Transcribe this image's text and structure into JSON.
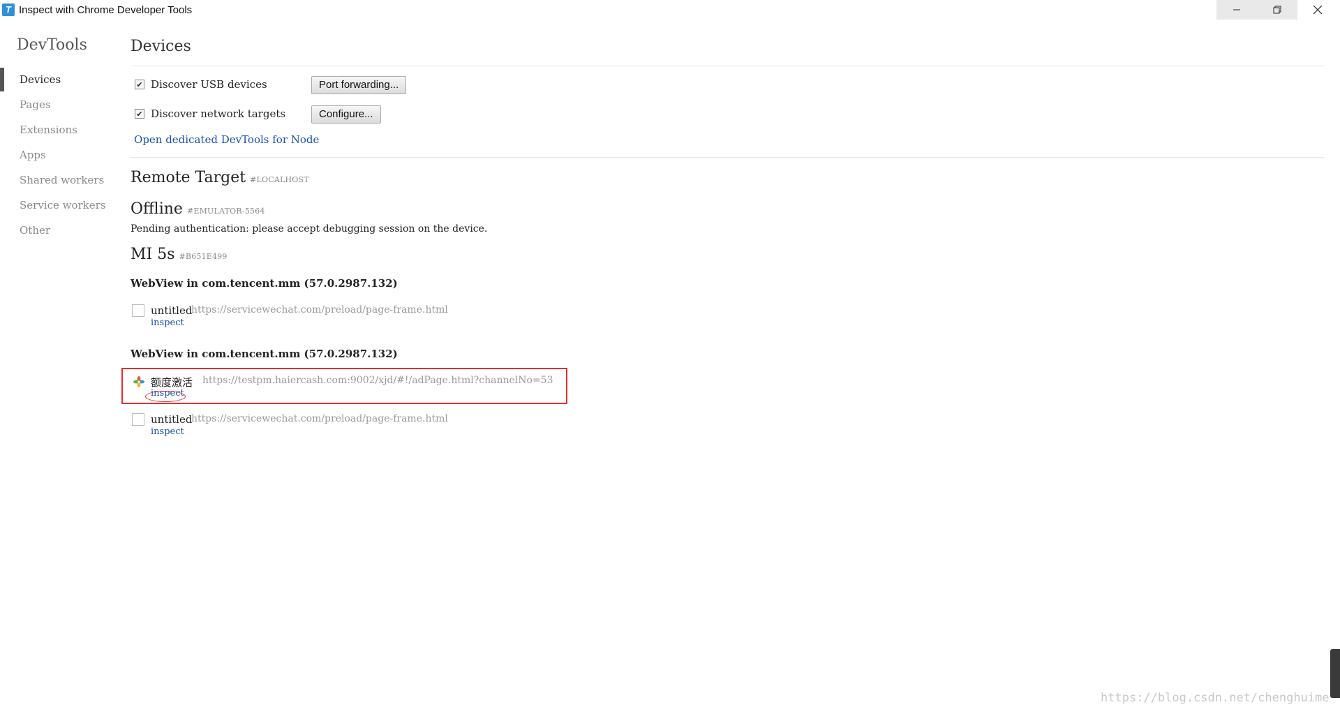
{
  "window": {
    "title": "Inspect with Chrome Developer Tools",
    "app_icon_glyph": "T"
  },
  "sidebar": {
    "title": "DevTools",
    "items": [
      {
        "label": "Devices",
        "active": true
      },
      {
        "label": "Pages",
        "active": false
      },
      {
        "label": "Extensions",
        "active": false
      },
      {
        "label": "Apps",
        "active": false
      },
      {
        "label": "Shared workers",
        "active": false
      },
      {
        "label": "Service workers",
        "active": false
      },
      {
        "label": "Other",
        "active": false
      }
    ]
  },
  "main": {
    "title": "Devices",
    "options": {
      "usb": {
        "label": "Discover USB devices",
        "checked": true,
        "button": "Port forwarding..."
      },
      "network": {
        "label": "Discover network targets",
        "checked": true,
        "button": "Configure..."
      }
    },
    "node_link": "Open dedicated DevTools for Node",
    "remote": {
      "heading": "Remote Target",
      "tag": "#LOCALHOST"
    },
    "offline": {
      "name": "Offline",
      "tag": "#EMULATOR-5564",
      "message": "Pending authentication: please accept debugging session on the device."
    },
    "device": {
      "name": "MI 5s",
      "tag": "#B651E499",
      "browsers": [
        {
          "title": "WebView in com.tencent.mm (57.0.2987.132)",
          "targets": [
            {
              "name": "untitled",
              "url": "https://servicewechat.com/preload/page-frame.html",
              "action": "inspect",
              "favicon": "blank"
            }
          ]
        },
        {
          "title": "WebView in com.tencent.mm (57.0.2987.132)",
          "targets": [
            {
              "name": "额度激活",
              "url": "https://testpm.haiercash.com:9002/xjd/#!/adPage.html?channelNo=53",
              "action": "inspect",
              "favicon": "flower-icon",
              "highlighted": true
            },
            {
              "name": "untitled",
              "url": "https://servicewechat.com/preload/page-frame.html",
              "action": "inspect",
              "favicon": "blank"
            }
          ]
        }
      ]
    }
  },
  "watermark": "https://blog.csdn.net/chenghuime",
  "colors": {
    "link": "#1a4fb5",
    "highlight": "#e03030",
    "active_bar": "#555555"
  }
}
